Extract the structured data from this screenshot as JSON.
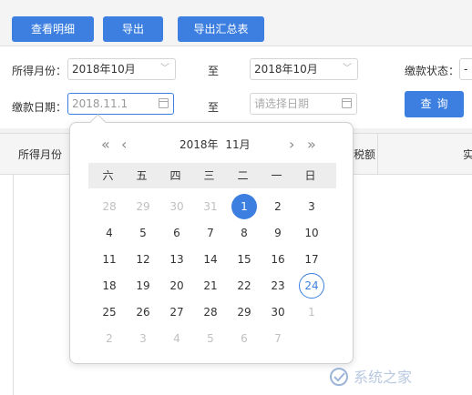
{
  "toolbar": {
    "btn_detail": "查看明细",
    "btn_export": "导出",
    "btn_export_summary": "导出汇总表"
  },
  "filters": {
    "income_month_label": "所得月份：",
    "income_month_from": "2018年10月",
    "to_label_1": "至",
    "income_month_to": "2018年10月",
    "payment_status_label": "缴款状态：",
    "payment_status_value": "-",
    "payment_date_label": "缴款日期：",
    "payment_date_from": "2018.11.1",
    "to_label_2": "至",
    "payment_date_to_placeholder": "请选择日期",
    "query_button": "查询"
  },
  "table": {
    "col_month": "所得月份",
    "col_tax": "税额",
    "col_actual": "实"
  },
  "calendar": {
    "title_year": "2018年",
    "title_month": "11月",
    "weekdays": [
      "六",
      "五",
      "四",
      "三",
      "二",
      "一",
      "日"
    ],
    "rows": [
      [
        {
          "d": "28",
          "s": "muted"
        },
        {
          "d": "29",
          "s": "muted"
        },
        {
          "d": "30",
          "s": "muted"
        },
        {
          "d": "31",
          "s": "muted"
        },
        {
          "d": "1",
          "s": "sel"
        },
        {
          "d": "2",
          "s": ""
        },
        {
          "d": "3",
          "s": ""
        }
      ],
      [
        {
          "d": "4",
          "s": ""
        },
        {
          "d": "5",
          "s": ""
        },
        {
          "d": "6",
          "s": ""
        },
        {
          "d": "7",
          "s": ""
        },
        {
          "d": "8",
          "s": ""
        },
        {
          "d": "9",
          "s": ""
        },
        {
          "d": "10",
          "s": ""
        }
      ],
      [
        {
          "d": "11",
          "s": ""
        },
        {
          "d": "12",
          "s": ""
        },
        {
          "d": "13",
          "s": ""
        },
        {
          "d": "14",
          "s": ""
        },
        {
          "d": "15",
          "s": ""
        },
        {
          "d": "16",
          "s": ""
        },
        {
          "d": "17",
          "s": ""
        }
      ],
      [
        {
          "d": "18",
          "s": ""
        },
        {
          "d": "19",
          "s": ""
        },
        {
          "d": "20",
          "s": ""
        },
        {
          "d": "21",
          "s": ""
        },
        {
          "d": "22",
          "s": ""
        },
        {
          "d": "23",
          "s": ""
        },
        {
          "d": "24",
          "s": "today"
        }
      ],
      [
        {
          "d": "25",
          "s": ""
        },
        {
          "d": "26",
          "s": ""
        },
        {
          "d": "27",
          "s": ""
        },
        {
          "d": "28",
          "s": ""
        },
        {
          "d": "29",
          "s": ""
        },
        {
          "d": "30",
          "s": ""
        },
        {
          "d": "1",
          "s": "muted"
        }
      ],
      [
        {
          "d": "2",
          "s": "muted"
        },
        {
          "d": "3",
          "s": "muted"
        },
        {
          "d": "4",
          "s": "muted"
        },
        {
          "d": "5",
          "s": "muted"
        },
        {
          "d": "6",
          "s": "muted"
        },
        {
          "d": "7",
          "s": "muted"
        }
      ]
    ]
  },
  "watermark": {
    "text": "系统之家"
  }
}
